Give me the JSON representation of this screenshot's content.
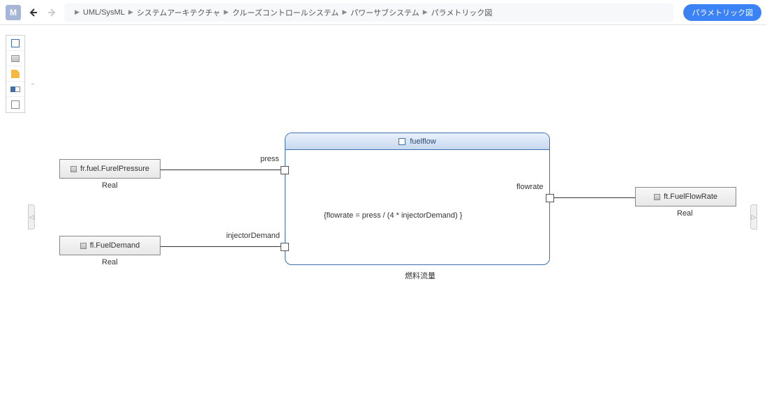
{
  "app": {
    "badge": "M"
  },
  "breadcrumb": {
    "items": [
      "UML/SysML",
      "システムアーキテクチャ",
      "クルーズコントロールシステム",
      "パワーサブシステム",
      "パラメトリック図"
    ]
  },
  "tagButton": {
    "label": "パラメトリック図"
  },
  "palette": {
    "items": [
      {
        "name": "constraint-rect"
      },
      {
        "name": "value-box"
      },
      {
        "name": "note"
      },
      {
        "name": "port-tool"
      },
      {
        "name": "empty-rect"
      }
    ]
  },
  "diagram": {
    "constraint": {
      "title": "fuelflow",
      "formula": "{flowrate = press / (4 * injectorDemand) }",
      "subtitle": "燃料流量",
      "ports": {
        "press": {
          "label": "press"
        },
        "injectorDemand": {
          "label": "injectorDemand"
        },
        "flowrate": {
          "label": "flowrate"
        }
      }
    },
    "values": {
      "fuelPressure": {
        "label": "fr.fuel.FurelPressure",
        "type": "Real"
      },
      "fuelDemand": {
        "label": "fl.FuelDemand",
        "type": "Real"
      },
      "fuelFlowRate": {
        "label": "ft.FuelFlowRate",
        "type": "Real"
      }
    }
  }
}
